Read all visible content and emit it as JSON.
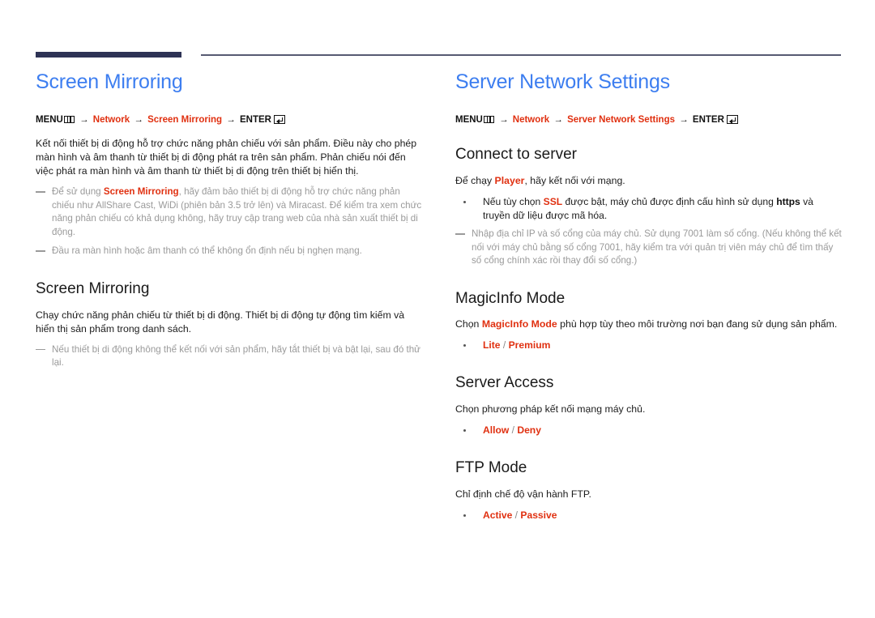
{
  "rule": {
    "thick_color": "#2e3355",
    "thin_color": "#575a72"
  },
  "colors": {
    "chapter_blue": "#3d7ef0",
    "accent_red": "#e03010",
    "note_gray": "#9a9a9a"
  },
  "left_column": {
    "chapter_title": "Screen Mirroring",
    "menu_path": {
      "menu_label": "MENU",
      "menu_icon": "menu-icon",
      "arrow": "→",
      "items": [
        "Network",
        "Screen Mirroring"
      ],
      "enter_label": "ENTER",
      "enter_icon": "enter-key-icon"
    },
    "intro": "Kết nối thiết bị di động hỗ trợ chức năng phản chiếu với sản phẩm. Điều này cho phép màn hình và âm thanh từ thiết bị di động phát ra trên sản phẩm. Phản chiếu nói đến việc phát ra màn hình và âm thanh từ thiết bị di động trên thiết bị hiển thị.",
    "note1_pre": "Để sử dụng ",
    "note1_red": "Screen Mirroring",
    "note1_post": ", hãy đảm bảo thiết bị di động hỗ trợ chức năng phản chiếu như AllShare Cast, WiDi (phiên bản 3.5 trở lên) và Miracast. Để kiểm tra xem chức năng phản chiếu có khả dụng không, hãy truy cập trang web của nhà sản xuất thiết bị di động.",
    "note2": "Đầu ra màn hình hoặc âm thanh có thể không ổn định nếu bị nghẹn mạng.",
    "section": {
      "heading": "Screen Mirroring",
      "body": "Chạy chức năng phản chiếu từ thiết bị di động. Thiết bị di động tự động tìm kiếm và hiển thị sản phẩm trong danh sách.",
      "note": "Nếu thiết bị di động không thể kết nối với sản phẩm, hãy tắt thiết bị và bật lại, sau đó thử lại."
    }
  },
  "right_column": {
    "chapter_title": "Server Network Settings",
    "menu_path": {
      "menu_label": "MENU",
      "menu_icon": "menu-icon",
      "arrow": "→",
      "items": [
        "Network",
        "Server Network Settings"
      ],
      "enter_label": "ENTER",
      "enter_icon": "enter-key-icon"
    },
    "connect": {
      "heading": "Connect to server",
      "lead_pre": "Để chạy ",
      "lead_red": "Player",
      "lead_post": ", hãy kết nối với mạng.",
      "bullet_pre": "Nếu tùy chọn ",
      "bullet_red": "SSL",
      "bullet_mid": " được bật, máy chủ được định cấu hình sử dụng ",
      "bullet_bold": "https",
      "bullet_post": " và truyền dữ liệu được mã hóa.",
      "note": "Nhập địa chỉ IP và số cổng của máy chủ. Sử dụng 7001 làm số cổng. (Nếu không thể kết nối với máy chủ bằng số cổng 7001, hãy kiểm tra với quản trị viên máy chủ để tìm thấy số cổng chính xác rồi thay đổi số cổng.)"
    },
    "magicinfo": {
      "heading": "MagicInfo Mode",
      "body_pre": "Chọn ",
      "body_red": "MagicInfo Mode",
      "body_post": " phù hợp tùy theo môi trường nơi bạn đang sử dụng sản phẩm.",
      "option_a": "Lite",
      "option_sep": " / ",
      "option_b": "Premium"
    },
    "server_access": {
      "heading": "Server Access",
      "body": "Chọn phương pháp kết nối mạng máy chủ.",
      "option_a": "Allow",
      "option_sep": " / ",
      "option_b": "Deny"
    },
    "ftp_mode": {
      "heading": "FTP Mode",
      "body": "Chỉ định chế độ vận hành FTP.",
      "option_a": "Active",
      "option_sep": " / ",
      "option_b": "Passive"
    }
  }
}
